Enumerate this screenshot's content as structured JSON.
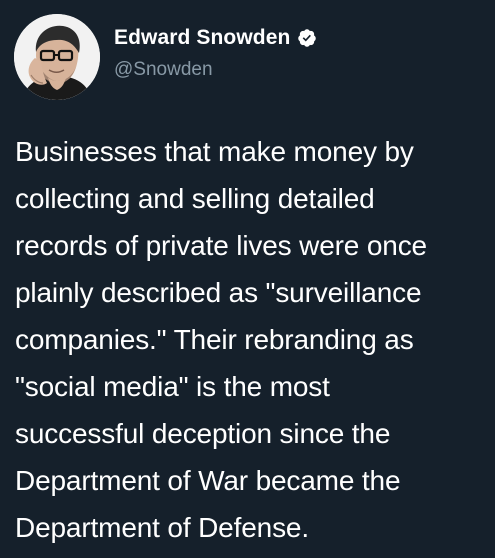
{
  "tweet": {
    "author": {
      "display_name": "Edward Snowden",
      "handle": "@Snowden",
      "verified": true
    },
    "text": "Businesses that make money by\ncollecting and selling detailed\nrecords of private lives were once\nplainly described as \"surveillance\ncompanies.\" Their rebranding as\n\"social media\" is the most\nsuccessful deception since the\nDepartment of War became the\nDepartment of Defense."
  },
  "colors": {
    "background": "#15202b",
    "primary_text": "#ffffff",
    "secondary_text": "#8899a6"
  }
}
